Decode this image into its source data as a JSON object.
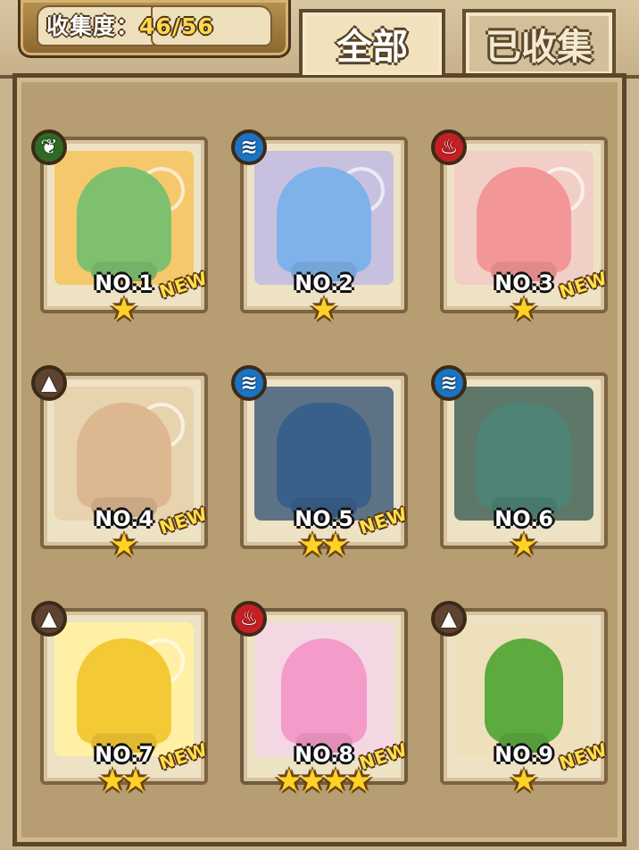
{
  "header": {
    "collection_label": "收集度",
    "collection_separator": "：",
    "collection_value": "46/56"
  },
  "tabs": [
    {
      "label": "全部",
      "active": true
    },
    {
      "label": "已收集",
      "active": false
    }
  ],
  "cards": [
    {
      "number": "NO.1",
      "element_icon": "leaf-icon",
      "element_color": "#2f6a23",
      "new": "NEW",
      "stars": 1,
      "art_color": "#7fc06f",
      "bg_color": "#f5c86c"
    },
    {
      "number": "NO.2",
      "element_icon": "water-icon",
      "element_color": "#1b73c1",
      "new": "",
      "stars": 1,
      "art_color": "#7fb2eb",
      "bg_color": "#c7c1df"
    },
    {
      "number": "NO.3",
      "element_icon": "fire-icon",
      "element_color": "#c51f25",
      "new": "NEW",
      "stars": 1,
      "art_color": "#f39697",
      "bg_color": "#f2cfc6"
    },
    {
      "number": "NO.4",
      "element_icon": "mountain-icon",
      "element_color": "#5d4330",
      "new": "NEW",
      "stars": 1,
      "art_color": "#ddb790",
      "bg_color": "#e8d3af"
    },
    {
      "number": "NO.5",
      "element_icon": "water-icon",
      "element_color": "#1b73c1",
      "new": "NEW",
      "stars": 2,
      "art_color": "#38608a",
      "bg_color": "#5e7286"
    },
    {
      "number": "NO.6",
      "element_icon": "water-icon",
      "element_color": "#1b73c1",
      "new": "",
      "stars": 1,
      "art_color": "#4e8376",
      "bg_color": "#5e7769"
    },
    {
      "number": "NO.7",
      "element_icon": "mountain-icon",
      "element_color": "#5d4330",
      "new": "NEW",
      "stars": 2,
      "art_color": "#f3c935",
      "bg_color": "#fff0a6"
    },
    {
      "number": "NO.8",
      "element_icon": "fire-icon",
      "element_color": "#c51f25",
      "new": "NEW",
      "stars": 4,
      "art_color": "#f59bc9",
      "bg_color": "#f3d7e3"
    },
    {
      "number": "NO.9",
      "element_icon": "mountain-icon",
      "element_color": "#5d4330",
      "new": "NEW",
      "stars": 1,
      "art_color": "#5daa3f",
      "bg_color": "#efe0bc"
    }
  ]
}
